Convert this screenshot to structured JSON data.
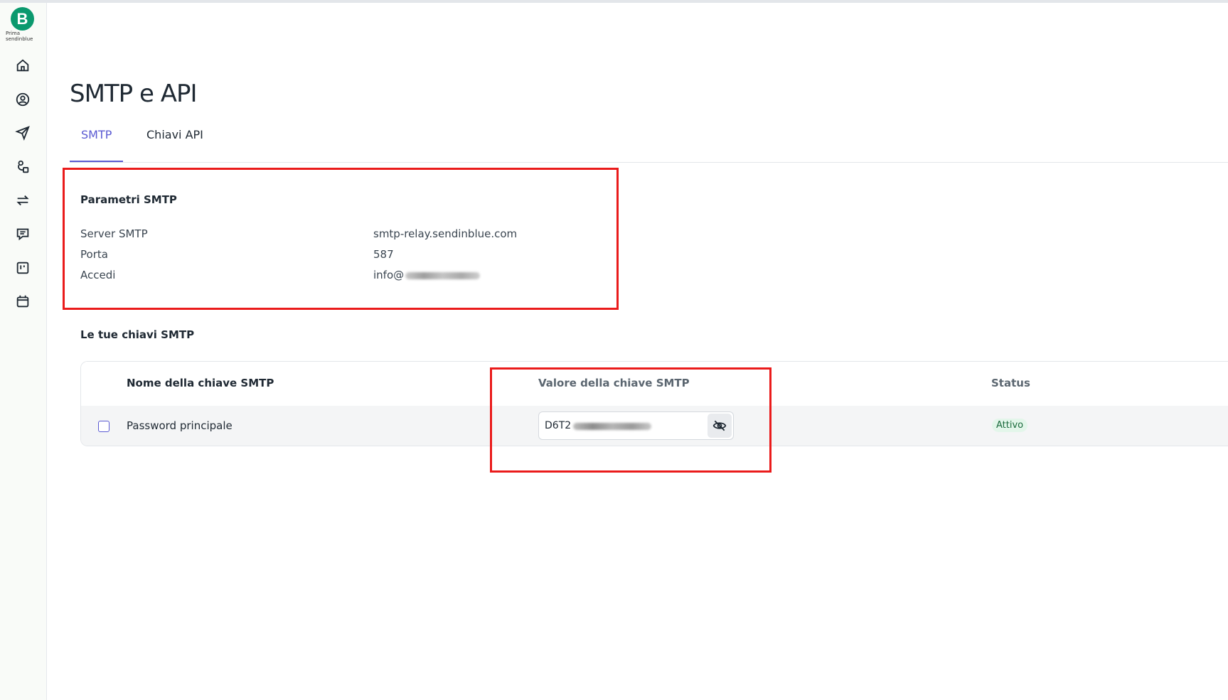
{
  "sidebar": {
    "logo_letter": "B",
    "logo_sub_line1": "Prima",
    "logo_sub_line2": "sendinblue",
    "items": [
      {
        "icon": "home-icon"
      },
      {
        "icon": "contacts-icon"
      },
      {
        "icon": "campaigns-icon"
      },
      {
        "icon": "automation-icon"
      },
      {
        "icon": "transactional-icon"
      },
      {
        "icon": "conversations-icon"
      },
      {
        "icon": "deals-icon"
      },
      {
        "icon": "calendar-icon"
      }
    ]
  },
  "page": {
    "title": "SMTP e API",
    "tabs": [
      {
        "label": "SMTP",
        "active": true
      },
      {
        "label": "Chiavi API",
        "active": false
      }
    ]
  },
  "smtp_params": {
    "title": "Parametri SMTP",
    "rows": [
      {
        "label": "Server SMTP",
        "value": "smtp-relay.sendinblue.com"
      },
      {
        "label": "Porta",
        "value": "587"
      },
      {
        "label": "Accedi",
        "value": "info@"
      }
    ]
  },
  "keys": {
    "title": "Le tue chiavi SMTP",
    "columns": {
      "name": "Nome della chiave SMTP",
      "value": "Valore della chiave SMTP",
      "status": "Status"
    },
    "rows": [
      {
        "name": "Password principale",
        "value_prefix": "D6T2",
        "status": "Attivo"
      }
    ]
  },
  "colors": {
    "accent": "#5a5ad2",
    "brand": "#0b996e",
    "highlight": "#ea1b1b",
    "status_active_bg": "#e3f6ea"
  }
}
